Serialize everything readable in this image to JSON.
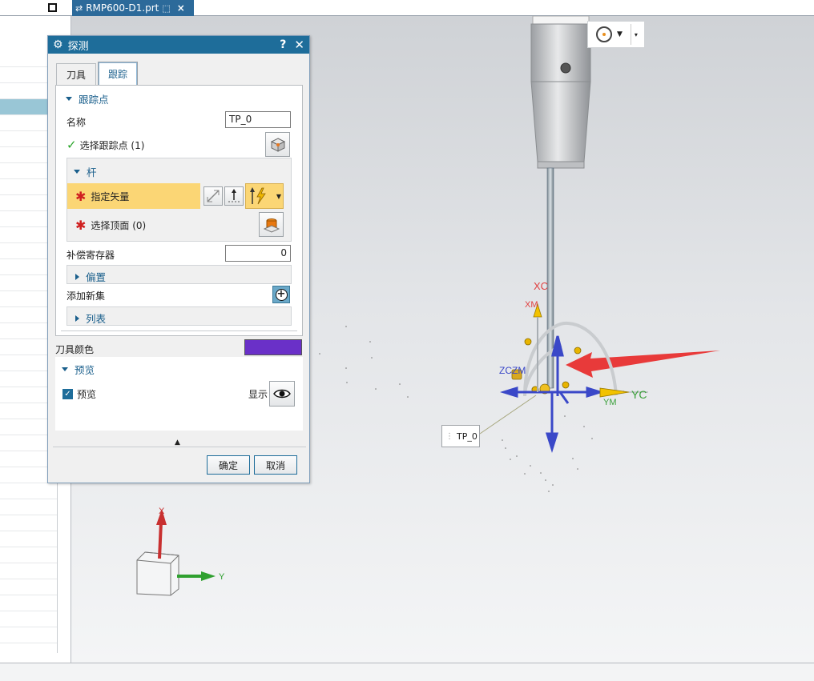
{
  "doc_tab": {
    "title": "RMP600-D1.prt",
    "close": "×"
  },
  "dialog": {
    "title": "探测",
    "help": "?",
    "close": "✕",
    "tabs": [
      {
        "label": "刀具"
      },
      {
        "label": "跟踪"
      }
    ],
    "active_tab": "跟踪",
    "tracking_section": {
      "header": "跟踪点",
      "name_label": "名称",
      "name_value": "TP_0",
      "select_point_label": "选择跟踪点 (1)",
      "rod": {
        "header": "杆",
        "specify_vector_label": "指定矢量",
        "select_top_label": "选择顶面 (0)"
      },
      "register_label": "补偿寄存器",
      "register_value": "0",
      "offset_header": "偏置",
      "add_set_label": "添加新集",
      "list_header": "列表"
    },
    "tool_color_label": "刀具颜色",
    "tool_color": "#6a30c8",
    "preview_section": {
      "header": "预览",
      "preview_checkbox_label": "预览",
      "preview_checked": true,
      "show_label": "显示"
    },
    "ok_label": "确定",
    "cancel_label": "取消"
  },
  "viewport": {
    "axis_labels": {
      "xc": "XC",
      "xm": "XM",
      "yc": "YC",
      "ym": "YM",
      "zczm": "ZCZM"
    },
    "tracking_point_tag": "TP_0",
    "triad_labels": {
      "x": "X",
      "y": "Y"
    }
  },
  "colors": {
    "title_bar": "#1e6d9a",
    "tab_active_text": "#1a5f8c",
    "highlight_row": "#fbd675",
    "required_star": "#d02020",
    "arrow_red": "#e83a3a",
    "axis_blue": "#3a48c8"
  }
}
